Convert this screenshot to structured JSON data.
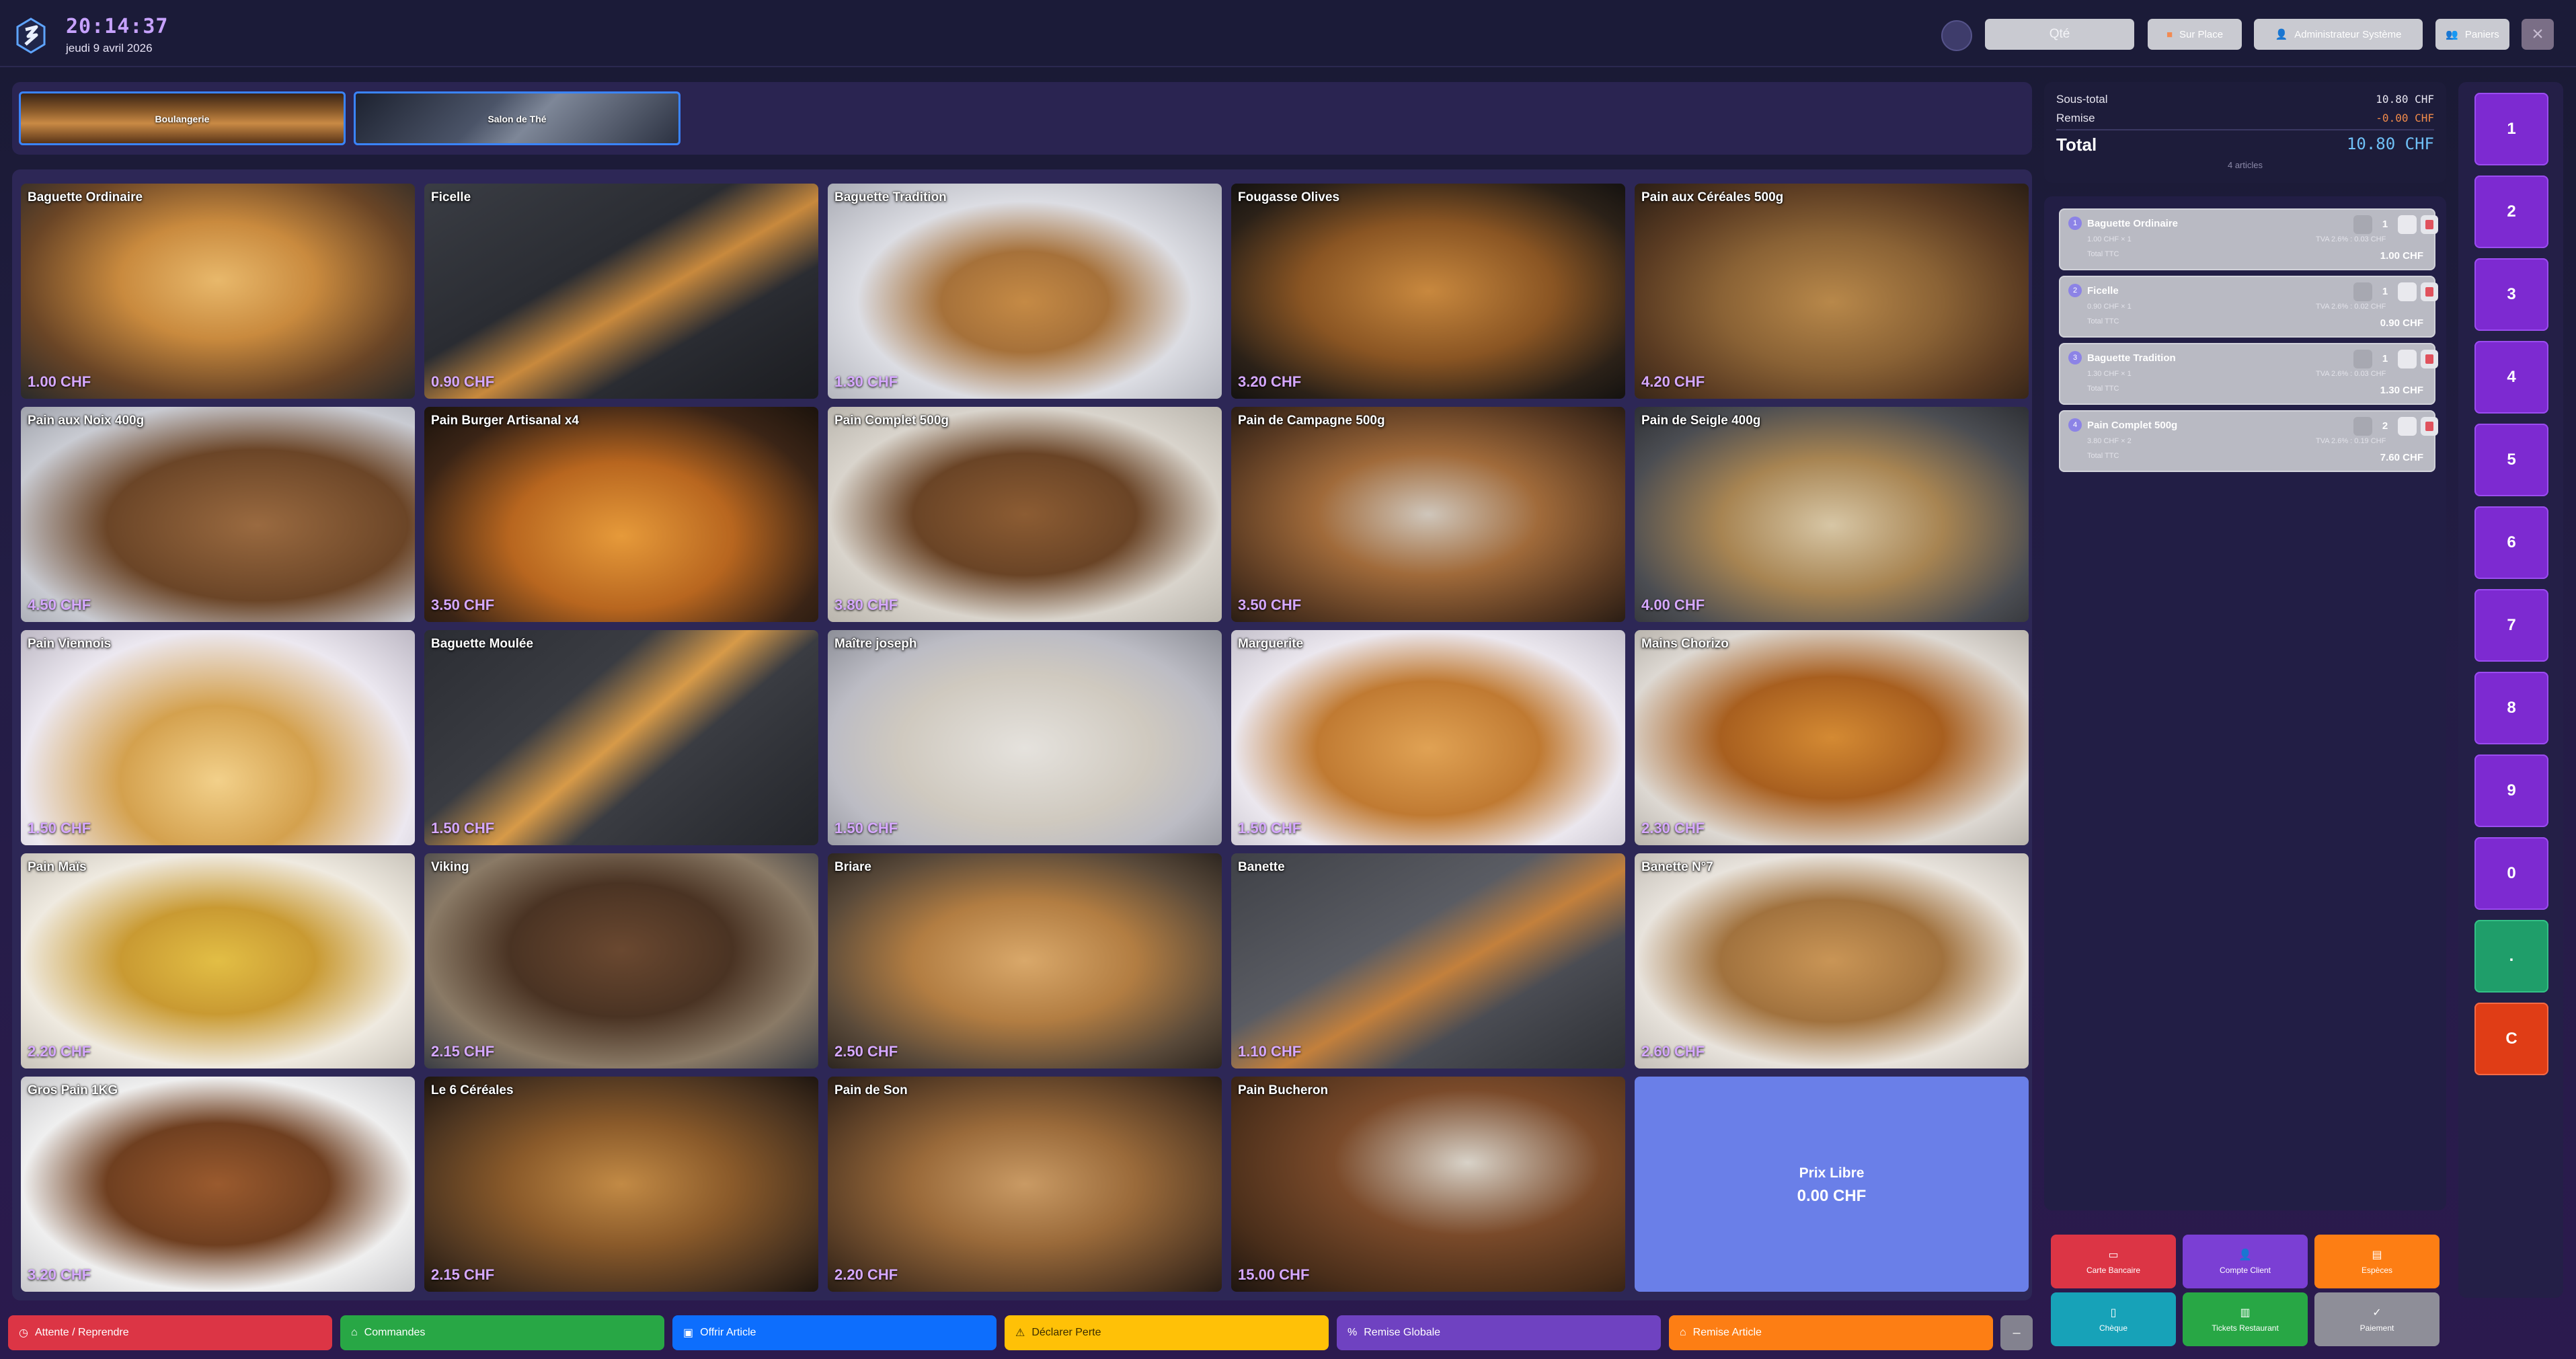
{
  "header": {
    "clock": "20:14:37",
    "date": "jeudi 9 avril 2026",
    "qte_placeholder": "Qté",
    "sur_place": "Sur Place",
    "user": "Administrateur Système",
    "paniers": "Paniers"
  },
  "categories": [
    {
      "label": "Boulangerie"
    },
    {
      "label": "Salon de Thé"
    }
  ],
  "products": [
    {
      "name": "Baguette Ordinaire",
      "price": "1.00 CHF"
    },
    {
      "name": "Ficelle",
      "price": "0.90 CHF"
    },
    {
      "name": "Baguette Tradition",
      "price": "1.30 CHF"
    },
    {
      "name": "Fougasse Olives",
      "price": "3.20 CHF"
    },
    {
      "name": "Pain aux Céréales 500g",
      "price": "4.20 CHF"
    },
    {
      "name": "Pain aux Noix 400g",
      "price": "4.50 CHF"
    },
    {
      "name": "Pain Burger Artisanal x4",
      "price": "3.50 CHF"
    },
    {
      "name": "Pain Complet 500g",
      "price": "3.80 CHF"
    },
    {
      "name": "Pain de Campagne 500g",
      "price": "3.50 CHF"
    },
    {
      "name": "Pain de Seigle 400g",
      "price": "4.00 CHF"
    },
    {
      "name": "Pain Viennois",
      "price": "1.50 CHF"
    },
    {
      "name": "Baguette Moulée",
      "price": "1.50 CHF"
    },
    {
      "name": "Maître joseph",
      "price": "1.50 CHF"
    },
    {
      "name": "Marguerite",
      "price": "1.50 CHF"
    },
    {
      "name": "Mains Chorizo",
      "price": "2.30 CHF"
    },
    {
      "name": "Pain Maïs",
      "price": "2.20 CHF"
    },
    {
      "name": "Viking",
      "price": "2.15 CHF"
    },
    {
      "name": "Briare",
      "price": "2.50 CHF"
    },
    {
      "name": "Banette",
      "price": "1.10 CHF"
    },
    {
      "name": "Banette N°7",
      "price": "2.60 CHF"
    },
    {
      "name": "Gros Pain 1KG",
      "price": "3.20 CHF"
    },
    {
      "name": "Le 6 Céréales",
      "price": "2.15 CHF"
    },
    {
      "name": "Pain de Son",
      "price": "2.20 CHF"
    },
    {
      "name": "Pain Bucheron",
      "price": "15.00 CHF"
    }
  ],
  "prix_libre": {
    "name": "Prix Libre",
    "price": "0.00 CHF"
  },
  "bottom_actions": [
    {
      "label": "Attente / Reprendre",
      "icon": "clock-icon",
      "color": "#dc3545"
    },
    {
      "label": "Commandes",
      "icon": "tag-icon",
      "color": "#28a745"
    },
    {
      "label": "Offrir Article",
      "icon": "gift-icon",
      "color": "#0d6efd"
    },
    {
      "label": "Déclarer Perte",
      "icon": "warning-icon",
      "color": "#ffc107"
    },
    {
      "label": "Remise Globale",
      "icon": "percent-icon",
      "color": "#6f42c1"
    },
    {
      "label": "Remise Article",
      "icon": "tag-icon",
      "color": "#fd7e14"
    }
  ],
  "summary": {
    "subtotal_label": "Sous-total",
    "subtotal_value": "10.80 CHF",
    "discount_label": "Remise",
    "discount_value": "-0.00 CHF",
    "total_label": "Total",
    "total_value": "10.80 CHF",
    "article_count": "4 articles"
  },
  "cart": [
    {
      "num": "1",
      "name": "Baguette Ordinaire",
      "unit": "1.00 CHF × 1",
      "tva": "TVA 2.6% : 0.03 CHF",
      "ttc_label": "Total TTC",
      "qty": "1",
      "total": "1.00 CHF"
    },
    {
      "num": "2",
      "name": "Ficelle",
      "unit": "0.90 CHF × 1",
      "tva": "TVA 2.6% : 0.02 CHF",
      "ttc_label": "Total TTC",
      "qty": "1",
      "total": "0.90 CHF"
    },
    {
      "num": "3",
      "name": "Baguette Tradition",
      "unit": "1.30 CHF × 1",
      "tva": "TVA 2.6% : 0.03 CHF",
      "ttc_label": "Total TTC",
      "qty": "1",
      "total": "1.30 CHF"
    },
    {
      "num": "4",
      "name": "Pain Complet 500g",
      "unit": "3.80 CHF × 2",
      "tva": "TVA 2.6% : 0.19 CHF",
      "ttc_label": "Total TTC",
      "qty": "2",
      "total": "7.60 CHF"
    }
  ],
  "payment": [
    {
      "label": "Carte Bancaire",
      "icon": "card-icon",
      "color": "#dc3545"
    },
    {
      "label": "Compte Client",
      "icon": "user-icon",
      "color": "#7b3fd4"
    },
    {
      "label": "Espèces",
      "icon": "cash-icon",
      "color": "#fd7e14"
    },
    {
      "label": "Chèque",
      "icon": "document-icon",
      "color": "#17a2b8"
    },
    {
      "label": "Tickets Restaurant",
      "icon": "ticket-icon",
      "color": "#28a745"
    },
    {
      "label": "Paiement",
      "icon": "check-icon",
      "color": "#8e8e98"
    }
  ],
  "numpad": [
    "1",
    "2",
    "3",
    "4",
    "5",
    "6",
    "7",
    "8",
    "9",
    "0",
    ".",
    "C"
  ]
}
